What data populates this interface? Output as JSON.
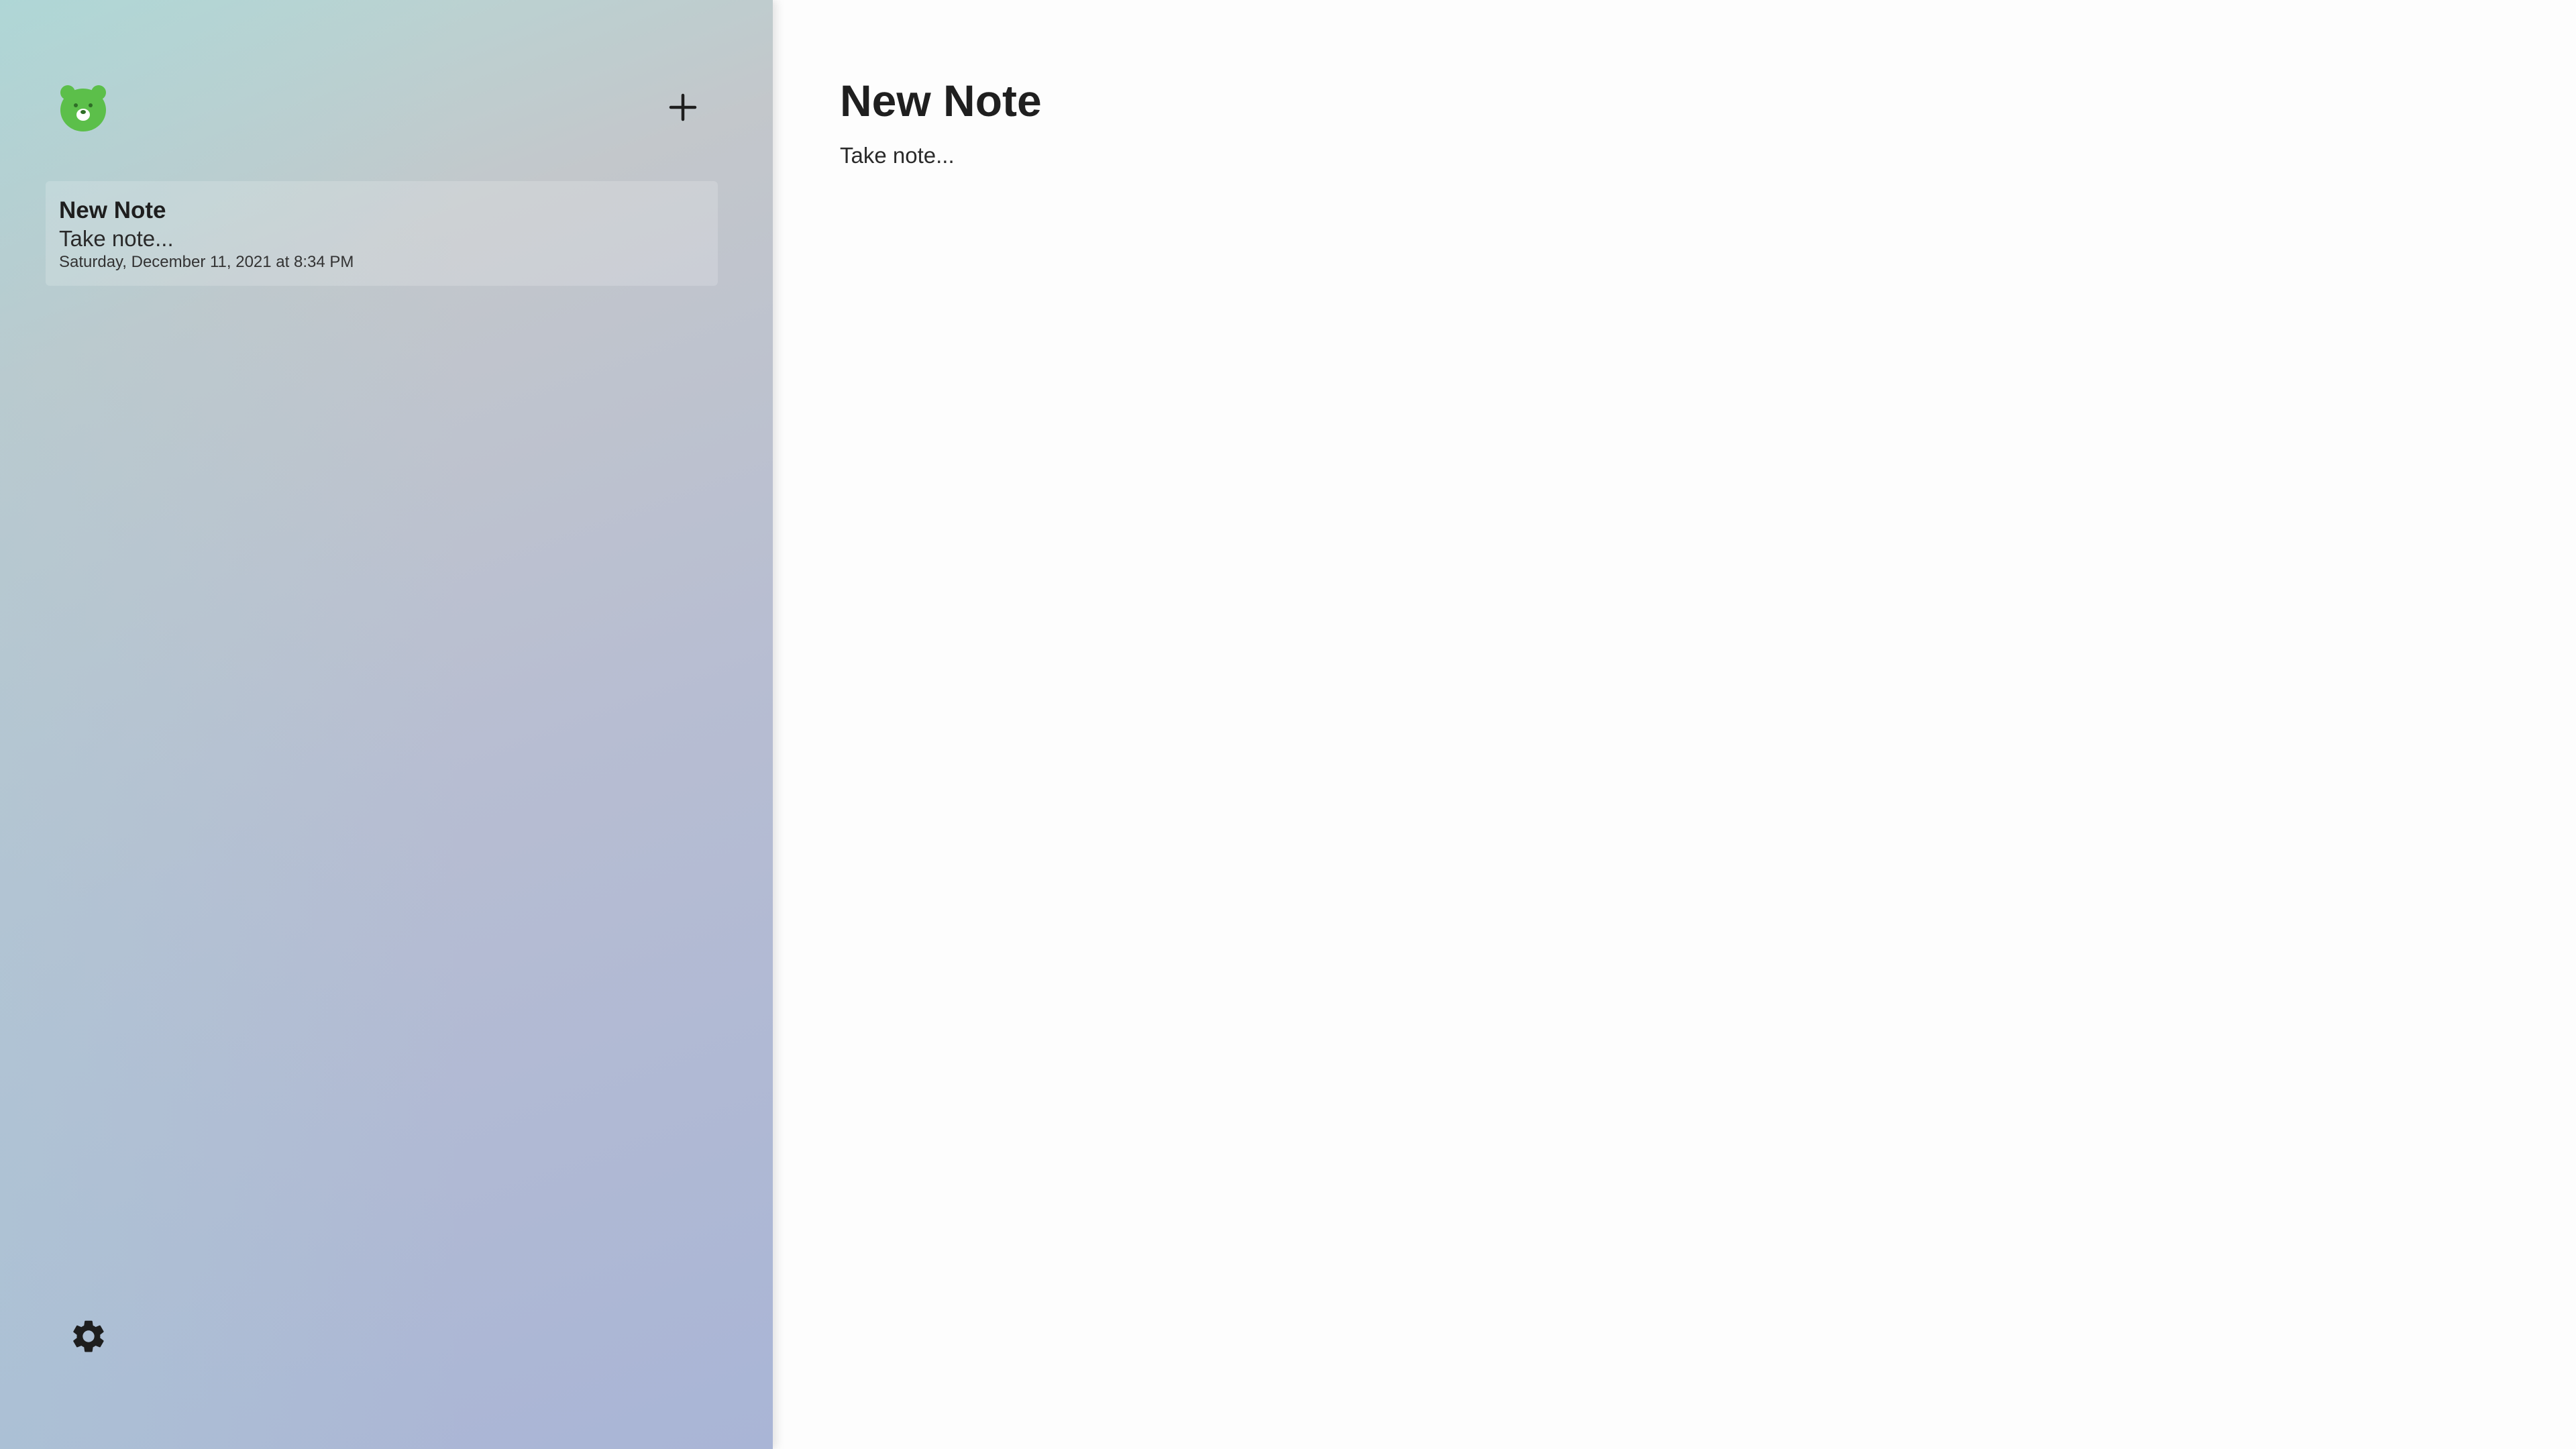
{
  "sidebar": {
    "logo_icon": "bear-logo-icon",
    "add_icon": "plus-icon",
    "settings_icon": "gear-icon",
    "notes": [
      {
        "title": "New Note",
        "preview": "Take note...",
        "date": "Saturday, December 11, 2021 at 8:34 PM"
      }
    ]
  },
  "editor": {
    "title": "New Note",
    "body": "Take note..."
  },
  "colors": {
    "logo_green": "#5cbf4a",
    "text": "#1f1f1f",
    "editor_background": "#fdfdfd"
  }
}
